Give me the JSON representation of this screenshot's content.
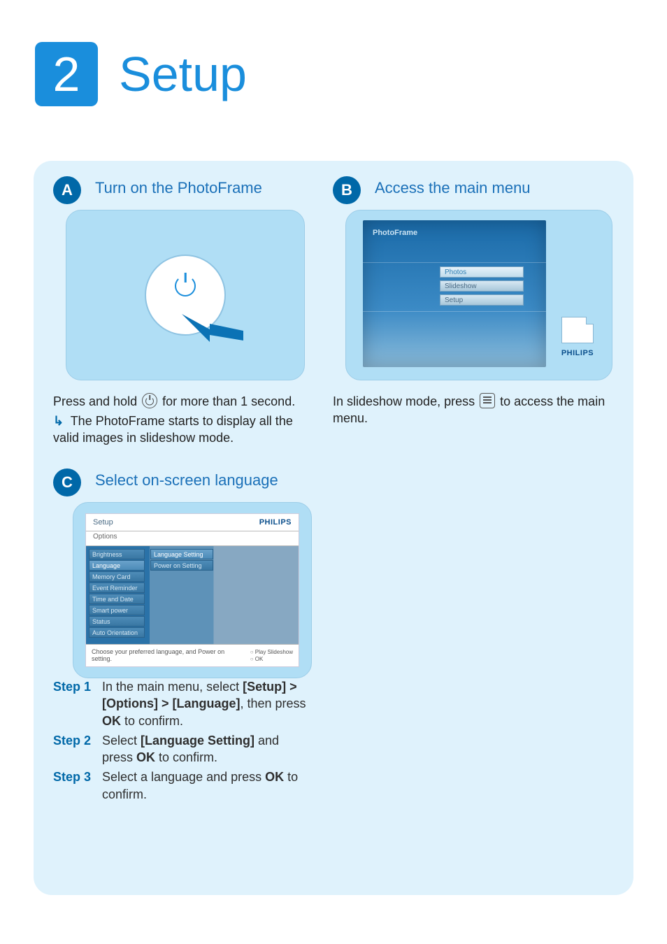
{
  "header": {
    "number": "2",
    "title": "Setup"
  },
  "sectionA": {
    "letter": "A",
    "title": "Turn on the PhotoFrame",
    "line1_a": "Press and hold ",
    "line1_b": " for more than 1 second.",
    "result": "The PhotoFrame starts to display all the valid images in slideshow mode."
  },
  "sectionB": {
    "letter": "B",
    "title": "Access the main menu",
    "screen_label": "PhotoFrame",
    "menu": [
      "Photos",
      "Slideshow",
      "Setup"
    ],
    "brand": "PHILIPS",
    "line1_a": "In slideshow mode, press ",
    "line1_b": " to  access the main menu."
  },
  "sectionC": {
    "letter": "C",
    "title": "Select on-screen language",
    "screen": {
      "head_left": "Setup",
      "head_right": "PHILIPS",
      "sub": "Options",
      "col1": [
        "Brightness",
        "Language",
        "Memory Card",
        "Event Reminder",
        "Time and Date",
        "Smart power",
        "Status",
        "Auto Orientation"
      ],
      "col2": [
        "Language Setting",
        "Power on Setting"
      ],
      "hint": "Choose your preferred language, and Power on setting.",
      "btns": [
        "Play Slideshow",
        "OK"
      ]
    },
    "steps": [
      {
        "label": "Step 1",
        "pre": "In the main menu, select ",
        "bold1": "[Setup] > [Options] > [Language]",
        "mid": ", then press ",
        "bold2": "OK",
        "post": " to confirm."
      },
      {
        "label": "Step 2",
        "pre": "Select ",
        "bold1": "[Language Setting]",
        "mid": " and press ",
        "bold2": "OK",
        "post": " to confirm."
      },
      {
        "label": "Step 3",
        "pre": "Select a language and press ",
        "bold1": "OK",
        "mid": "",
        "bold2": "",
        "post": " to confirm."
      }
    ]
  }
}
